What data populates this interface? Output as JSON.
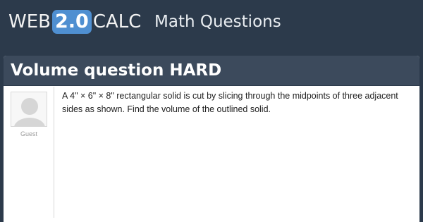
{
  "header": {
    "logo": {
      "part1": "WEB",
      "badge": "2.0",
      "part2": "CALC"
    },
    "section": "Math Questions",
    "colors": {
      "background": "#2c3a4b",
      "badge": "#4f8fd1",
      "title_bar": "#3c4a5c"
    }
  },
  "question": {
    "title": "Volume question HARD",
    "user": {
      "name": "Guest",
      "avatar_icon": "default-avatar-icon"
    },
    "text": "A 4\" × 6\" × 8\" rectangular solid is cut by slicing through the midpoints of three adjacent sides as shown. Find the volume of the outlined solid."
  }
}
